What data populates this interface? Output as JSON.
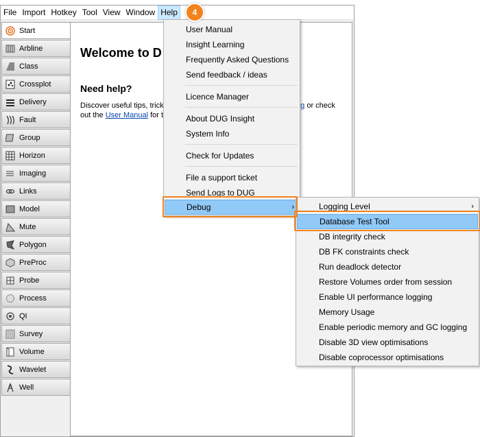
{
  "menubar": {
    "items": [
      "File",
      "Import",
      "Hotkey",
      "Tool",
      "View",
      "Window",
      "Help"
    ]
  },
  "sidebar": {
    "items": [
      {
        "label": "Start",
        "icon": "start-icon"
      },
      {
        "label": "Arbline",
        "icon": "arbline-icon"
      },
      {
        "label": "Class",
        "icon": "class-icon"
      },
      {
        "label": "Crossplot",
        "icon": "crossplot-icon"
      },
      {
        "label": "Delivery",
        "icon": "delivery-icon"
      },
      {
        "label": "Fault",
        "icon": "fault-icon"
      },
      {
        "label": "Group",
        "icon": "group-icon"
      },
      {
        "label": "Horizon",
        "icon": "horizon-icon"
      },
      {
        "label": "Imaging",
        "icon": "imaging-icon"
      },
      {
        "label": "Links",
        "icon": "links-icon"
      },
      {
        "label": "Model",
        "icon": "model-icon"
      },
      {
        "label": "Mute",
        "icon": "mute-icon"
      },
      {
        "label": "Polygon",
        "icon": "polygon-icon"
      },
      {
        "label": "PreProc",
        "icon": "preproc-icon"
      },
      {
        "label": "Probe",
        "icon": "probe-icon"
      },
      {
        "label": "Process",
        "icon": "process-icon"
      },
      {
        "label": "QI",
        "icon": "qi-icon"
      },
      {
        "label": "Survey",
        "icon": "survey-icon"
      },
      {
        "label": "Volume",
        "icon": "volume-icon"
      },
      {
        "label": "Wavelet",
        "icon": "wavelet-icon"
      },
      {
        "label": "Well",
        "icon": "well-icon"
      }
    ]
  },
  "content": {
    "title": "Welcome to D",
    "help_heading": "Need help?",
    "line1_start": "Discover useful tips, tricks",
    "line1_link": "g",
    "line1_end": " or check",
    "line2_start": "out the ",
    "line2_link": "User Manual",
    "line2_end": " for t"
  },
  "help_menu": {
    "items": [
      "User Manual",
      "Insight Learning",
      "Frequently Asked Questions",
      "Send feedback / ideas",
      "Licence Manager",
      "About DUG Insight",
      "System Info",
      "Check for Updates",
      "File a support ticket",
      "Send Logs to DUG",
      "Debug"
    ]
  },
  "debug_menu": {
    "items": [
      "Logging Level",
      "Database Test Tool",
      "DB integrity check",
      "DB FK constraints check",
      "Run deadlock detector",
      "Restore Volumes order from session",
      "Enable UI performance logging",
      "Memory Usage",
      "Enable periodic memory and GC logging",
      "Disable 3D view optimisations",
      "Disable coprocessor optimisations"
    ]
  },
  "annotation": {
    "step": "4",
    "color": "#f0831e"
  },
  "colors": {
    "highlight": "#91c9f7",
    "menu_active": "#cce8ff",
    "link": "#0645ad"
  }
}
